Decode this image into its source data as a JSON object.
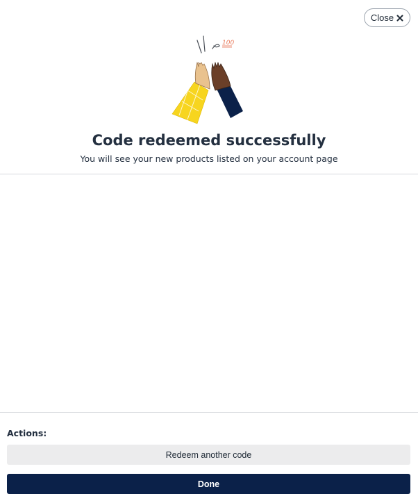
{
  "modal": {
    "close_label": "Close",
    "close_icon": "close-x-icon",
    "illustration_icon": "high-five-illustration",
    "illustration_badge": "100",
    "title": "Code redeemed successfully",
    "subtitle": "You will see your new products listed on your account page"
  },
  "actions": {
    "heading": "Actions:",
    "redeem_another_label": "Redeem another code",
    "done_label": "Done"
  },
  "colors": {
    "primary": "#0b2149",
    "secondary_bg": "#ececed",
    "sleeve_yellow": "#f7d51f"
  }
}
